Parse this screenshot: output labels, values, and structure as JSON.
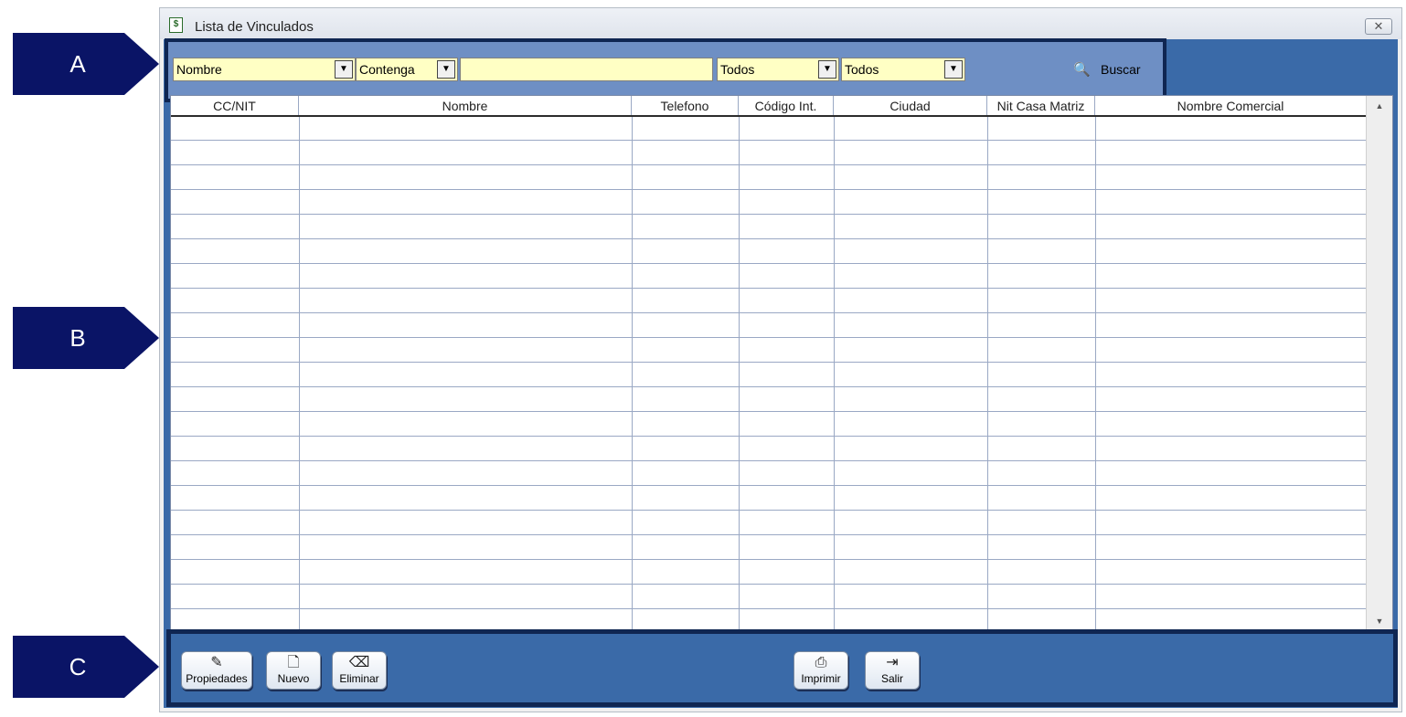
{
  "callouts": {
    "a": "A",
    "b": "B",
    "c": "C"
  },
  "window": {
    "title": "Lista de Vinculados",
    "close_glyph": "✕"
  },
  "filter": {
    "field_select": "Nombre",
    "operator_select": "Contenga",
    "search_text": "",
    "filter1_select": "Todos",
    "filter2_select": "Todos",
    "search_button": "Buscar"
  },
  "grid": {
    "columns": [
      "CC/NIT",
      "Nombre",
      "Telefono",
      "Código Int.",
      "Ciudad",
      "Nit Casa Matriz",
      "Nombre Comercial"
    ],
    "rows": []
  },
  "buttons": {
    "properties": "Propiedades",
    "new": "Nuevo",
    "delete": "Eliminar",
    "print": "Imprimir",
    "exit": "Salir"
  },
  "icons": {
    "app": "spreadsheet-icon",
    "search": "search-icon",
    "properties": "edit-document-icon",
    "new": "new-document-icon",
    "delete": "eraser-icon",
    "print": "printer-icon",
    "exit": "exit-door-icon"
  },
  "colors": {
    "window_bg": "#3a6aa8",
    "filter_bg": "#6e8fc4",
    "frame": "#0f2652",
    "input_bg": "#ffffc4",
    "callout": "#0a1466"
  }
}
